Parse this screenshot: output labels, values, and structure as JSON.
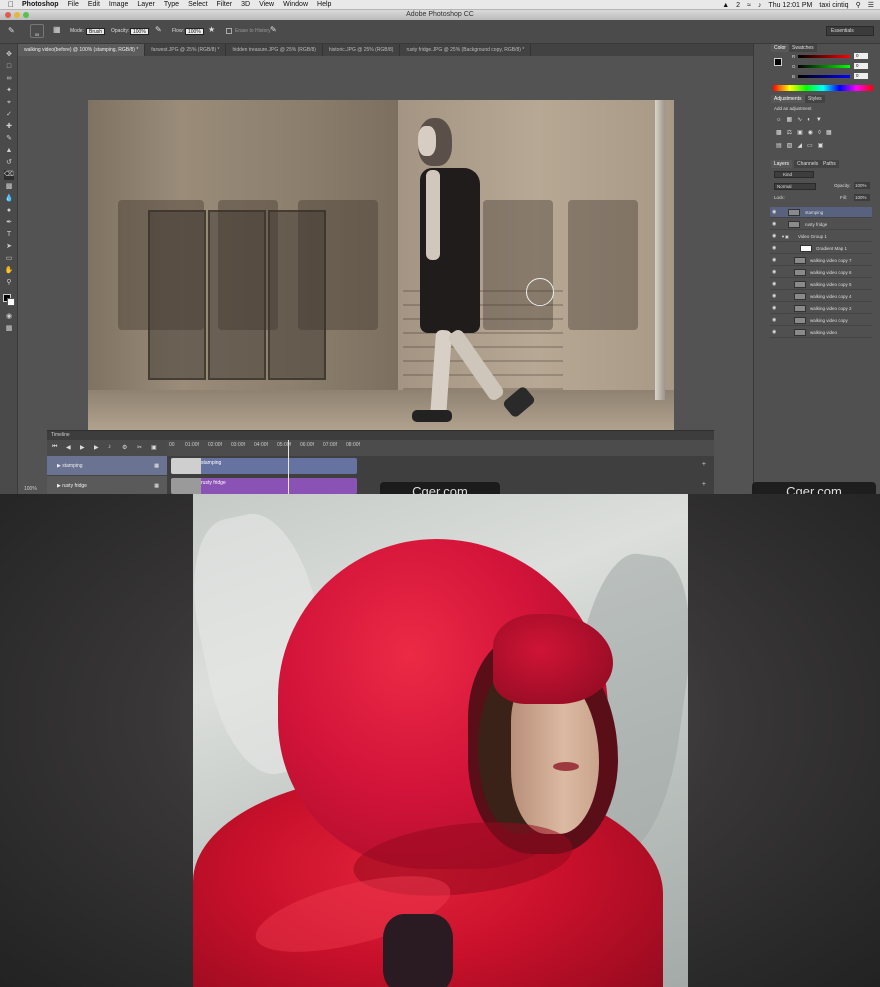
{
  "menubar": {
    "app": "Photoshop",
    "items": [
      "File",
      "Edit",
      "Image",
      "Layer",
      "Type",
      "Select",
      "Filter",
      "3D",
      "View",
      "Window",
      "Help"
    ],
    "status_num": "2",
    "clock": "Thu 12:01 PM",
    "user": "taxi cintiq"
  },
  "window": {
    "title": "Adobe Photoshop CC"
  },
  "options": {
    "brush_size": "55",
    "mode_label": "Mode:",
    "mode_value": "Brush",
    "opacity_label": "Opacity:",
    "opacity_value": "100%",
    "flow_label": "Flow:",
    "flow_value": "100%",
    "erase_history": "Erase to History",
    "workspace": "Essentials"
  },
  "tabs": [
    "walking video(before) @ 100% (stamping, RGB/8) *",
    "farwest.JPG @ 25% (RGB/8) *",
    "hidden treasure.JPG @ 25% (RGB/8)",
    "historic.JPG @ 25% (RGB/8)",
    "rusty fridge.JPG @ 25% (Background copy, RGB/8) *"
  ],
  "timeline": {
    "title": "Timeline",
    "ticks": [
      "00",
      "01:00f",
      "02:00f",
      "03:00f",
      "04:00f",
      "05:00f",
      "06:00f",
      "07:00f",
      "08:00f"
    ],
    "tracks": [
      {
        "label": "stamping",
        "clip": "stamping"
      },
      {
        "label": "rusty fridge",
        "clip": "rusty fridge"
      }
    ],
    "zoom": "100%"
  },
  "panels": {
    "color_tab": "Color",
    "swatches_tab": "Swatches",
    "rgb_labels": [
      "R",
      "G",
      "B"
    ],
    "rgb_values": [
      "0",
      "0",
      "0"
    ],
    "adjustments_tab": "Adjustments",
    "styles_tab": "Styles",
    "add_adjustment": "Add an adjustment",
    "layers_tab": "Layers",
    "channels_tab": "Channels",
    "paths_tab": "Paths",
    "kind": "Kind",
    "blend_mode": "Normal",
    "opacity_label": "Opacity:",
    "opacity_value": "100%",
    "lock_label": "Lock:",
    "fill_label": "Fill:",
    "fill_value": "100%",
    "layers": [
      "stamping",
      "rusty fridge",
      "Video Group 1",
      "Gradient Map 1",
      "walking video copy 7",
      "walking video copy 6",
      "walking video copy 5",
      "walking video copy 4",
      "walking video copy 2",
      "walking video copy",
      "walking video"
    ]
  },
  "watermark": "Cger.com"
}
